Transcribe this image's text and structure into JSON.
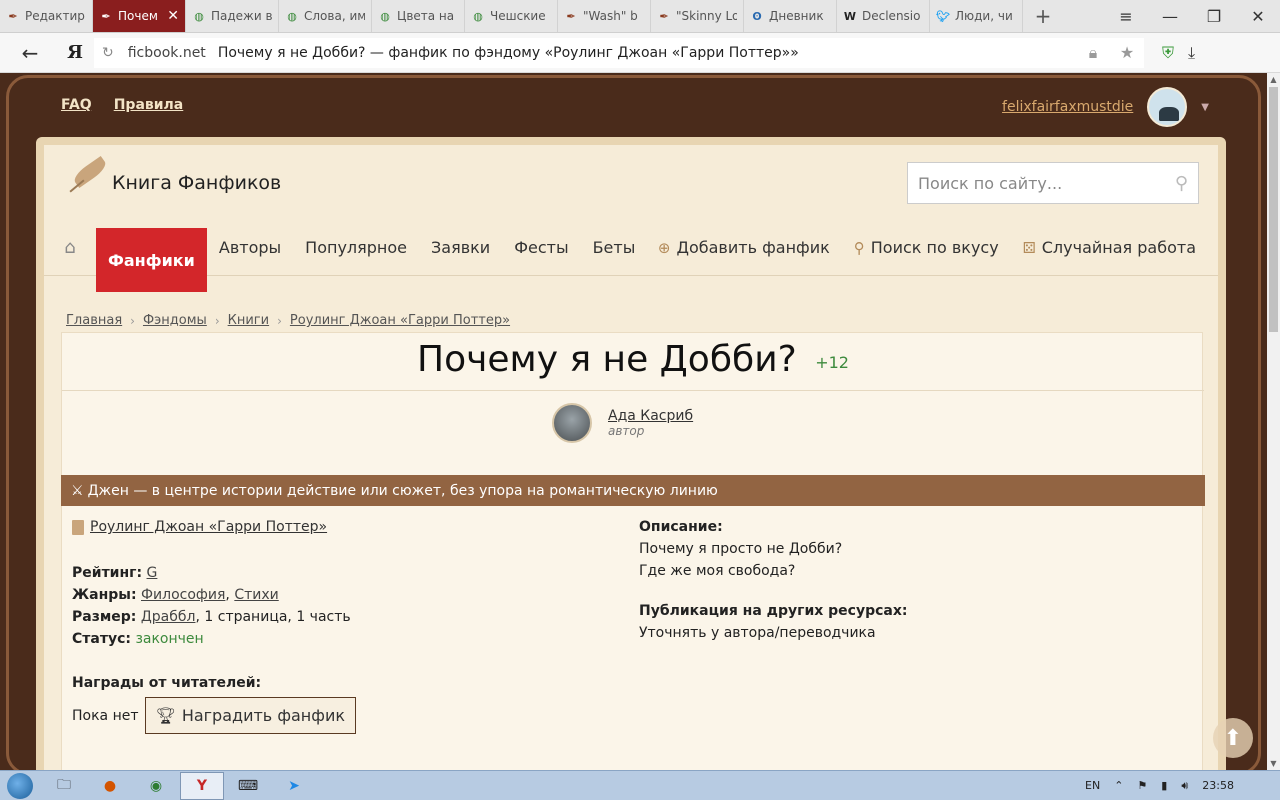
{
  "browser": {
    "tabs": [
      {
        "label": "Редактир",
        "icon": "quill-icon",
        "active": false
      },
      {
        "label": "Почем",
        "icon": "quill-icon",
        "active": true
      },
      {
        "label": "Падежи в",
        "icon": "globe-icon",
        "active": false
      },
      {
        "label": "Слова, им",
        "icon": "globe-icon",
        "active": false
      },
      {
        "label": "Цвета на",
        "icon": "globe-icon",
        "active": false
      },
      {
        "label": "Чешские",
        "icon": "globe-icon",
        "active": false
      },
      {
        "label": "\"Wash\" b",
        "icon": "quill-icon",
        "active": false
      },
      {
        "label": "\"Skinny Lo",
        "icon": "quill-icon",
        "active": false
      },
      {
        "label": "Дневник",
        "icon": "diary-icon",
        "active": false
      },
      {
        "label": "Declensio",
        "icon": "wikipedia-icon",
        "active": false
      },
      {
        "label": "Люди, чи",
        "icon": "twitter-icon",
        "active": false
      }
    ],
    "new_tab": "+",
    "window_controls": [
      "≡",
      "—",
      "❐",
      "✕"
    ],
    "back": "←",
    "yandex_logo": "Я",
    "url_host": "ficbook.net",
    "url_title": "Почему я не Добби? — фанфик по фэндому «Роулинг Джоан «Гарри Поттер»»"
  },
  "site": {
    "faq": "FAQ",
    "rules": "Правила",
    "username": "felixfairfaxmustdie",
    "logo_text": "Книга Фанфиков",
    "search_placeholder": "Поиск по сайту...",
    "nav": {
      "fanfics": "Фанфики",
      "authors": "Авторы",
      "popular": "Популярное",
      "requests": "Заявки",
      "fests": "Фесты",
      "betas": "Беты",
      "add_fanfic": "Добавить фанфик",
      "search_taste": "Поиск по вкусу",
      "random": "Случайная работа"
    },
    "breadcrumbs": [
      "Главная",
      "Фэндомы",
      "Книги",
      "Роулинг Джоан «Гарри Поттер»"
    ]
  },
  "fic": {
    "title": "Почему я не Добби?",
    "likes": "+12",
    "author_name": "Ада Касриб",
    "author_role": "автор",
    "genre_banner": "Джен — в центре истории действие или сюжет, без упора на романтическую линию",
    "fandom": "Роулинг Джоан «Гарри Поттер»",
    "rating_label": "Рейтинг:",
    "rating_value": "G",
    "genres_label": "Жанры:",
    "genre_1": "Философия",
    "genre_sep": ",",
    "genre_2": "Стихи",
    "size_label": "Размер:",
    "size_value": "Драббл",
    "size_rest": ", 1 страница, 1 часть",
    "status_label": "Статус:",
    "status_value": "закончен",
    "awards_label": "Награды от читателей:",
    "awards_none": "Пока нет",
    "award_button": "Наградить фанфик",
    "desc_label": "Описание:",
    "desc_line1": "Почему я просто не Добби?",
    "desc_line2": "Где же моя свобода?",
    "pub_label": "Публикация на других ресурсах:",
    "pub_value": "Уточнять у автора/переводчика"
  },
  "taskbar": {
    "lang": "EN",
    "time": "23:58"
  }
}
